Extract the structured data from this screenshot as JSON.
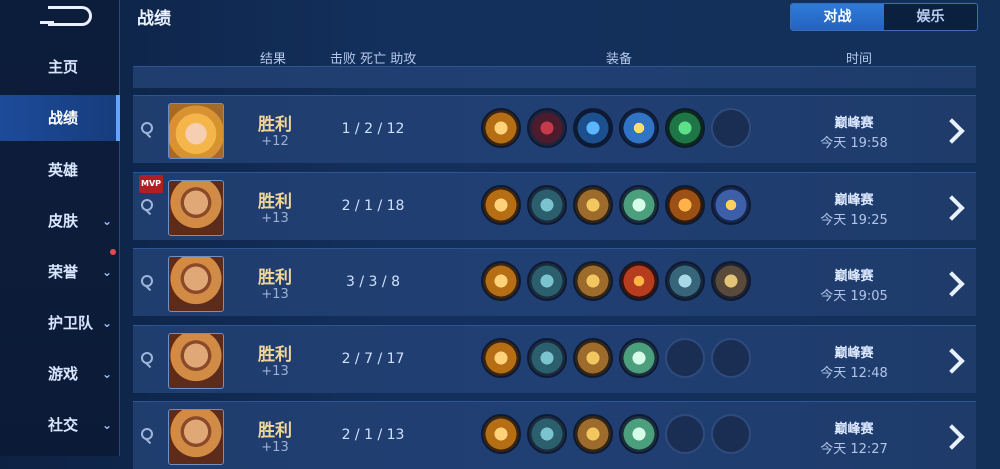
{
  "sidebar": {
    "items": [
      {
        "label": "主页",
        "active": false,
        "chevron": false
      },
      {
        "label": "战绩",
        "active": true,
        "chevron": false
      },
      {
        "label": "英雄",
        "active": false,
        "chevron": false
      },
      {
        "label": "皮肤",
        "active": false,
        "chevron": true
      },
      {
        "label": "荣誉",
        "active": false,
        "chevron": true,
        "dot": true
      },
      {
        "label": "护卫队",
        "active": false,
        "chevron": true
      },
      {
        "label": "游戏",
        "active": false,
        "chevron": true
      },
      {
        "label": "社交",
        "active": false,
        "chevron": true
      }
    ],
    "chevron_glyph": "⌄"
  },
  "header": {
    "title": "战绩",
    "tabs": [
      {
        "label": "对战",
        "active": true
      },
      {
        "label": "娱乐",
        "active": false
      }
    ]
  },
  "columns": {
    "result": "结果",
    "kda": "击败 死亡 助攻",
    "equipment": "装备",
    "time": "时间"
  },
  "matches": [
    {
      "hero": "blonde",
      "mvp": false,
      "result": "胜利",
      "points": "+12",
      "kda": "1 / 2 / 12",
      "items": [
        "c-gold",
        "c-sword",
        "c-blue",
        "c-wand",
        "c-green",
        "empty"
      ],
      "type": "巅峰赛",
      "time": "今天 19:58"
    },
    {
      "hero": "warrior",
      "mvp": true,
      "mvp_label": "MVP",
      "result": "胜利",
      "points": "+13",
      "kda": "2 / 1 / 18",
      "items": [
        "c-gold",
        "c-boot",
        "c-armor",
        "c-crystal",
        "c-helm",
        "c-knight"
      ],
      "type": "巅峰赛",
      "time": "今天 19:25"
    },
    {
      "hero": "warrior",
      "mvp": false,
      "result": "胜利",
      "points": "+13",
      "kda": "3 / 3 / 8",
      "items": [
        "c-gold",
        "c-boot",
        "c-armor",
        "c-red",
        "c-steel",
        "c-tower"
      ],
      "type": "巅峰赛",
      "time": "今天 19:05"
    },
    {
      "hero": "warrior",
      "mvp": false,
      "result": "胜利",
      "points": "+13",
      "kda": "2 / 7 / 17",
      "items": [
        "c-gold",
        "c-boot",
        "c-armor",
        "c-crystal",
        "empty",
        "empty"
      ],
      "type": "巅峰赛",
      "time": "今天 12:48"
    },
    {
      "hero": "warrior",
      "mvp": false,
      "result": "胜利",
      "points": "+13",
      "kda": "2 / 1 / 13",
      "items": [
        "c-gold",
        "c-boot",
        "c-armor",
        "c-crystal",
        "empty",
        "empty"
      ],
      "type": "巅峰赛",
      "time": "今天 12:27"
    }
  ]
}
